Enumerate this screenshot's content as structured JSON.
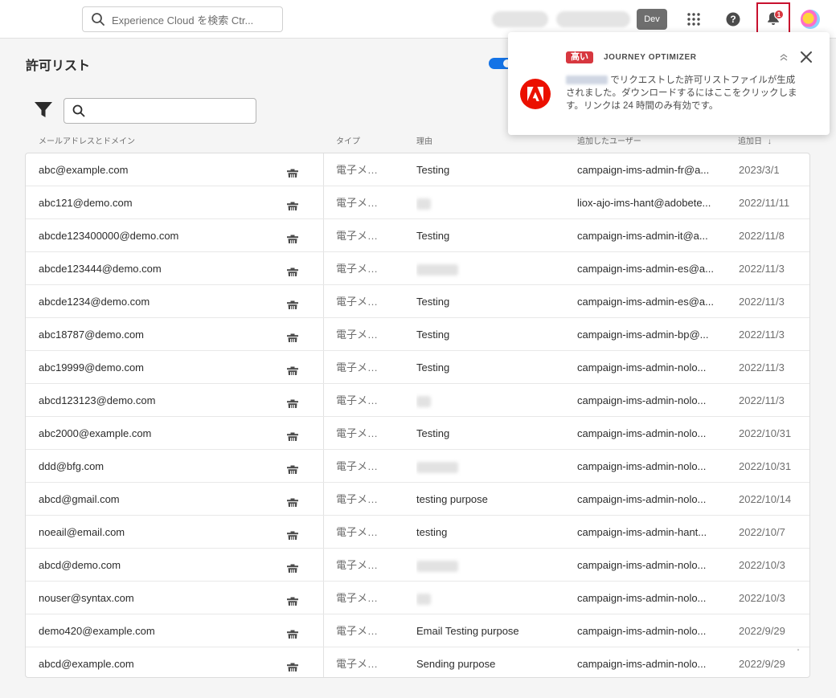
{
  "topbar": {
    "search_placeholder": "Experience Cloud を検索 Ctr...",
    "env_badge": "Dev",
    "notification_count": "1"
  },
  "page": {
    "title": "許可リスト"
  },
  "table": {
    "columns": {
      "email": "メールアドレスとドメイン",
      "type": "タイプ",
      "reason": "理由",
      "added_by": "追加したユーザー",
      "added_date": "追加日"
    },
    "sort_indicator": "↓",
    "rows": [
      {
        "email": "abc@example.com",
        "type": "電子メ…",
        "reason": "Testing",
        "added_by": "campaign-ims-admin-fr@a...",
        "date": "2023/3/1"
      },
      {
        "email": "abc121@demo.com",
        "type": "電子メ…",
        "reason": "",
        "added_by": "liox-ajo-ims-hant@adobete...",
        "date": "2022/11/11"
      },
      {
        "email": "abcde123400000@demo.com",
        "type": "電子メ…",
        "reason": "Testing",
        "added_by": "campaign-ims-admin-it@a...",
        "date": "2022/11/8"
      },
      {
        "email": "abcde123444@demo.com",
        "type": "電子メ…",
        "reason": "",
        "added_by": "campaign-ims-admin-es@a...",
        "date": "2022/11/3"
      },
      {
        "email": "abcde1234@demo.com",
        "type": "電子メ…",
        "reason": "Testing",
        "added_by": "campaign-ims-admin-es@a...",
        "date": "2022/11/3"
      },
      {
        "email": "abc18787@demo.com",
        "type": "電子メ…",
        "reason": "Testing",
        "added_by": "campaign-ims-admin-bp@...",
        "date": "2022/11/3"
      },
      {
        "email": "abc19999@demo.com",
        "type": "電子メ…",
        "reason": "Testing",
        "added_by": "campaign-ims-admin-nolo...",
        "date": "2022/11/3"
      },
      {
        "email": "abcd123123@demo.com",
        "type": "電子メ…",
        "reason": "",
        "added_by": "campaign-ims-admin-nolo...",
        "date": "2022/11/3"
      },
      {
        "email": "abc2000@example.com",
        "type": "電子メ…",
        "reason": "Testing",
        "added_by": "campaign-ims-admin-nolo...",
        "date": "2022/10/31"
      },
      {
        "email": "ddd@bfg.com",
        "type": "電子メ…",
        "reason": "",
        "added_by": "campaign-ims-admin-nolo...",
        "date": "2022/10/31"
      },
      {
        "email": "abcd@gmail.com",
        "type": "電子メ…",
        "reason": "testing purpose",
        "added_by": "campaign-ims-admin-nolo...",
        "date": "2022/10/14"
      },
      {
        "email": "noeail@email.com",
        "type": "電子メ…",
        "reason": "testing",
        "added_by": "campaign-ims-admin-hant...",
        "date": "2022/10/7"
      },
      {
        "email": "abcd@demo.com",
        "type": "電子メ…",
        "reason": "",
        "added_by": "campaign-ims-admin-nolo...",
        "date": "2022/10/3"
      },
      {
        "email": "nouser@syntax.com",
        "type": "電子メ…",
        "reason": "",
        "added_by": "campaign-ims-admin-nolo...",
        "date": "2022/10/3"
      },
      {
        "email": "demo420@example.com",
        "type": "電子メ…",
        "reason": "Email Testing purpose",
        "added_by": "campaign-ims-admin-nolo...",
        "date": "2022/9/29"
      },
      {
        "email": "abcd@example.com",
        "type": "電子メ…",
        "reason": "Sending purpose",
        "added_by": "campaign-ims-admin-nolo...",
        "date": "2022/9/29"
      }
    ]
  },
  "notification": {
    "priority": "高い",
    "source": "JOURNEY OPTIMIZER",
    "message": "でリクエストした許可リストファイルが生成されました。ダウンロードするにはここをクリックします。リンクは 24 時間のみ有効です。"
  },
  "colors": {
    "accent": "#1473e6",
    "adobe_red": "#eb1000",
    "priority_red": "#d7373f",
    "highlight_border": "#c8102e"
  }
}
